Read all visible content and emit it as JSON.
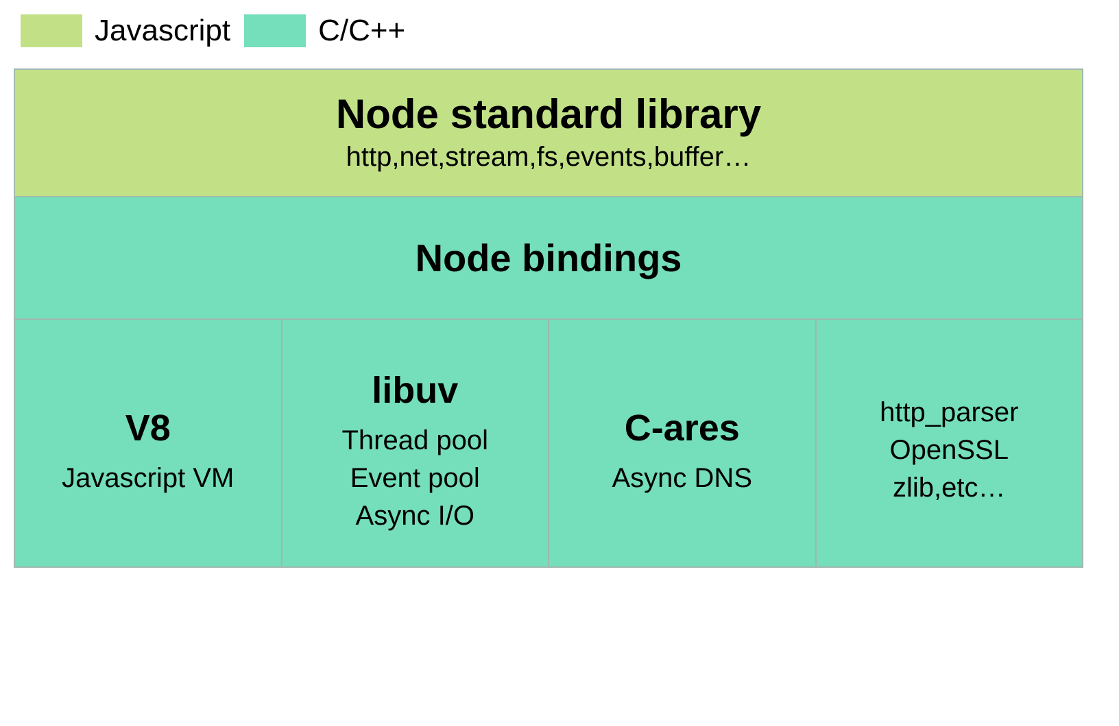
{
  "legend": {
    "js_label": "Javascript",
    "c_label": "C/C++"
  },
  "colors": {
    "js": "#c2e187",
    "c": "#75deba",
    "border": "#9fb8ae"
  },
  "layers": {
    "stdlib": {
      "title": "Node standard library",
      "subtitle": "http,net,stream,fs,events,buffer…"
    },
    "bindings": {
      "title": "Node bindings"
    },
    "boxes": [
      {
        "title": "V8",
        "lines": [
          "Javascript VM"
        ]
      },
      {
        "title": "libuv",
        "lines": [
          "Thread pool",
          "Event pool",
          "Async I/O"
        ]
      },
      {
        "title": "C-ares",
        "lines": [
          "Async DNS"
        ]
      },
      {
        "title": "",
        "lines": [
          "http_parser",
          "OpenSSL",
          "zlib,etc…"
        ]
      }
    ]
  }
}
